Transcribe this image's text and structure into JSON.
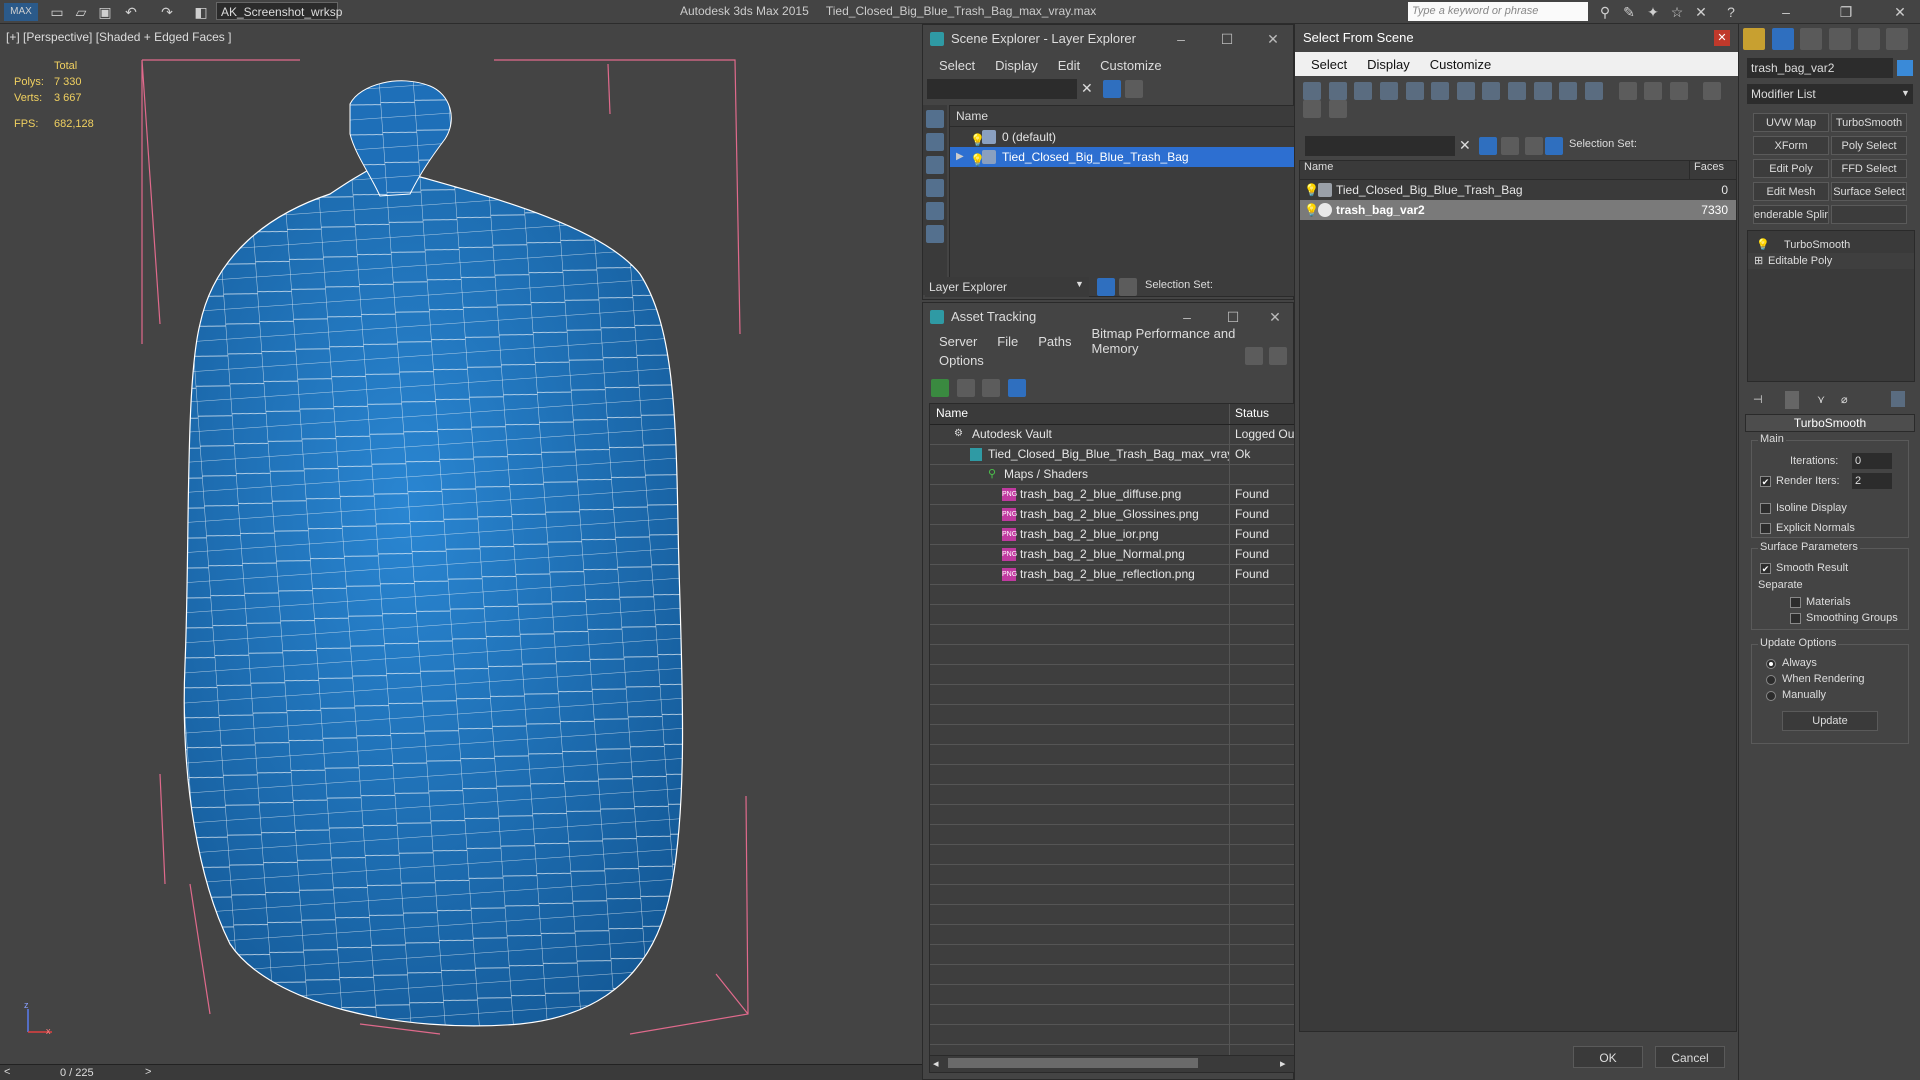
{
  "titlebar": {
    "workspace": "AK_Screenshot_wrksp",
    "app_name": "Autodesk 3ds Max  2015",
    "file_name": "Tied_Closed_Big_Blue_Trash_Bag_max_vray.max",
    "search_placeholder": "Type a keyword or phrase"
  },
  "viewport": {
    "label": "[+] [Perspective] [Shaded + Edged Faces ]",
    "stats_header": "Total",
    "polys_label": "Polys:",
    "polys_value": "7 330",
    "verts_label": "Verts:",
    "verts_value": "3 667",
    "fps_label": "FPS:",
    "fps_value": "682,128",
    "axis_z": "z",
    "axis_x": "x",
    "mesh_color": "#1e6fb8"
  },
  "timeline": {
    "frame": "0 / 225"
  },
  "scene_explorer": {
    "title": "Scene Explorer - Layer Explorer",
    "menu": [
      "Select",
      "Display",
      "Edit",
      "Customize"
    ],
    "column_name": "Name",
    "rows": [
      {
        "label": "0 (default)"
      },
      {
        "label": "Tied_Closed_Big_Blue_Trash_Bag"
      }
    ],
    "bottom_combo": "Layer Explorer",
    "selection_set": "Selection Set:"
  },
  "asset_tracking": {
    "title": "Asset Tracking",
    "menu": [
      "Server",
      "File",
      "Paths",
      "Bitmap Performance and Memory"
    ],
    "menu2": "Options",
    "col_name": "Name",
    "col_status": "Status",
    "rows": [
      {
        "name": "Autodesk Vault",
        "status": "Logged Ou"
      },
      {
        "name": "Tied_Closed_Big_Blue_Trash_Bag_max_vray....",
        "status": "Ok"
      },
      {
        "name": "Maps / Shaders",
        "status": ""
      },
      {
        "name": "trash_bag_2_blue_diffuse.png",
        "status": "Found"
      },
      {
        "name": "trash_bag_2_blue_Glossines.png",
        "status": "Found"
      },
      {
        "name": "trash_bag_2_blue_ior.png",
        "status": "Found"
      },
      {
        "name": "trash_bag_2_blue_Normal.png",
        "status": "Found"
      },
      {
        "name": "trash_bag_2_blue_reflection.png",
        "status": "Found"
      }
    ]
  },
  "select_from_scene": {
    "title": "Select From Scene",
    "menu": [
      "Select",
      "Display",
      "Customize"
    ],
    "selection_set": "Selection Set:",
    "col_name": "Name",
    "col_faces": "Faces",
    "rows": [
      {
        "name": "Tied_Closed_Big_Blue_Trash_Bag",
        "faces": "0"
      },
      {
        "name": "trash_bag_var2",
        "faces": "7330"
      }
    ],
    "ok": "OK",
    "cancel": "Cancel"
  },
  "command_panel": {
    "object_name": "trash_bag_var2",
    "modifier_list": "Modifier List",
    "buttons": [
      "UVW Map",
      "TurboSmooth",
      "XForm",
      "Poly Select",
      "Edit Poly",
      "FFD Select",
      "Edit Mesh",
      "Surface Select",
      "enderable Splir",
      ""
    ],
    "stack": [
      "TurboSmooth",
      "Editable Poly"
    ],
    "rollout_title": "TurboSmooth",
    "main_label": "Main",
    "iterations_label": "Iterations:",
    "iterations_value": "0",
    "render_iters_label": "Render Iters:",
    "render_iters_value": "2",
    "isoline": "Isoline Display",
    "explicit_normals": "Explicit Normals",
    "surface_params": "Surface Parameters",
    "smooth_result": "Smooth Result",
    "separate": "Separate",
    "materials": "Materials",
    "smoothing_groups": "Smoothing Groups",
    "update_options": "Update Options",
    "always": "Always",
    "when_rendering": "When Rendering",
    "manually": "Manually",
    "update": "Update"
  }
}
